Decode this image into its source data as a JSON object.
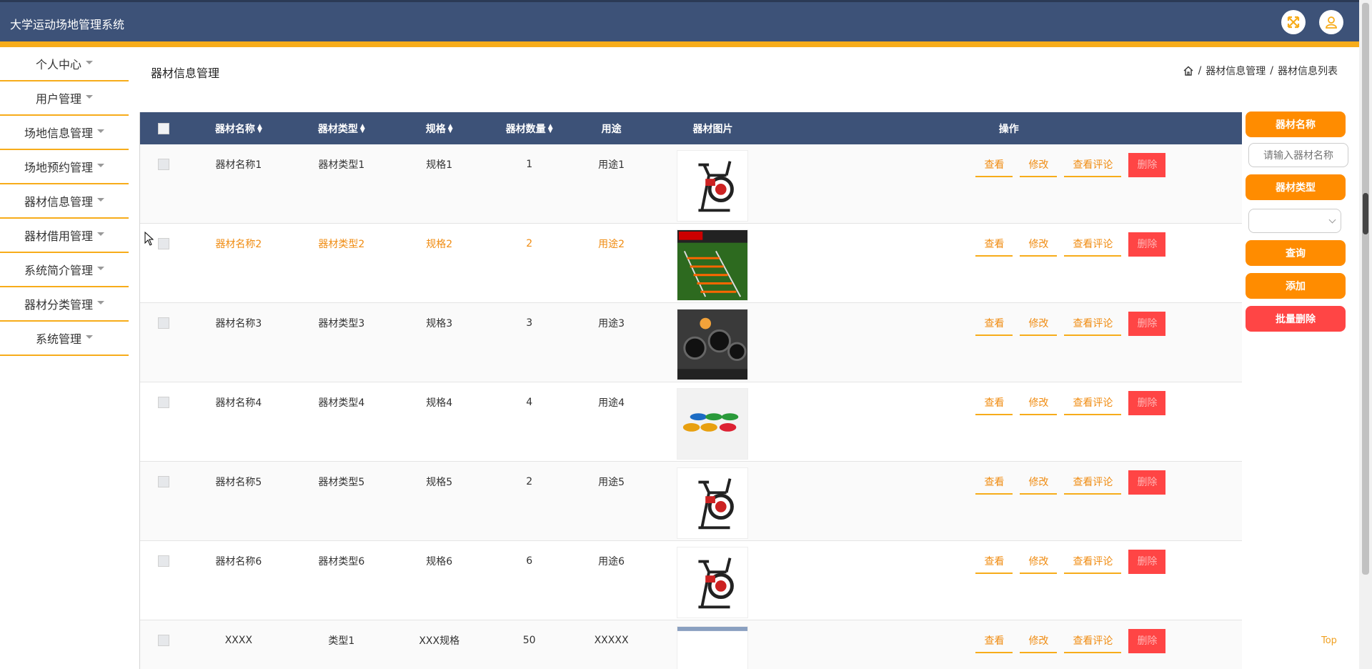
{
  "header": {
    "title": "大学运动场地管理系统"
  },
  "sidebar": {
    "items": [
      {
        "label": "个人中心"
      },
      {
        "label": "用户管理"
      },
      {
        "label": "场地信息管理"
      },
      {
        "label": "场地预约管理"
      },
      {
        "label": "器材信息管理"
      },
      {
        "label": "器材借用管理"
      },
      {
        "label": "系统简介管理"
      },
      {
        "label": "器材分类管理"
      },
      {
        "label": "系统管理"
      }
    ]
  },
  "page": {
    "title": "器材信息管理",
    "breadcrumb": {
      "sep": "/",
      "level1": "器材信息管理",
      "level2": "器材信息列表"
    }
  },
  "table": {
    "columns": {
      "name": "器材名称",
      "type": "器材类型",
      "spec": "规格",
      "qty": "器材数量",
      "use": "用途",
      "image": "器材图片",
      "ops": "操作"
    },
    "actions": {
      "view": "查看",
      "edit": "修改",
      "comments": "查看评论",
      "delete": "删除"
    },
    "rows": [
      {
        "name": "器材名称1",
        "type": "器材类型1",
        "spec": "规格1",
        "qty": "1",
        "use": "用途1",
        "image_icon": "spin-bike-image"
      },
      {
        "name": "器材名称2",
        "type": "器材类型2",
        "spec": "规格2",
        "qty": "2",
        "use": "用途2",
        "image_icon": "agility-ladder-image"
      },
      {
        "name": "器材名称3",
        "type": "器材类型3",
        "spec": "规格3",
        "qty": "3",
        "use": "用途3",
        "image_icon": "gym-bikes-image"
      },
      {
        "name": "器材名称4",
        "type": "器材类型4",
        "spec": "规格4",
        "qty": "4",
        "use": "用途4",
        "image_icon": "agility-dots-image"
      },
      {
        "name": "器材名称5",
        "type": "器材类型5",
        "spec": "规格5",
        "qty": "2",
        "use": "用途5",
        "image_icon": "spin-bike-image"
      },
      {
        "name": "器材名称6",
        "type": "器材类型6",
        "spec": "规格6",
        "qty": "6",
        "use": "用途6",
        "image_icon": "spin-bike-image"
      },
      {
        "name": "XXXX",
        "type": "类型1",
        "spec": "XXX规格",
        "qty": "50",
        "use": "XXXXX",
        "image_icon": "equipment-image"
      }
    ]
  },
  "search": {
    "name_label": "器材名称",
    "name_placeholder": "请输入器材名称",
    "type_label": "器材类型",
    "query": "查询",
    "add": "添加",
    "batch_delete": "批量删除"
  },
  "footer": {
    "top": "Top"
  },
  "colors": {
    "header": "#3d5278",
    "accent": "#f7ac1a",
    "button": "#ff8c00",
    "danger": "#ff4545"
  }
}
